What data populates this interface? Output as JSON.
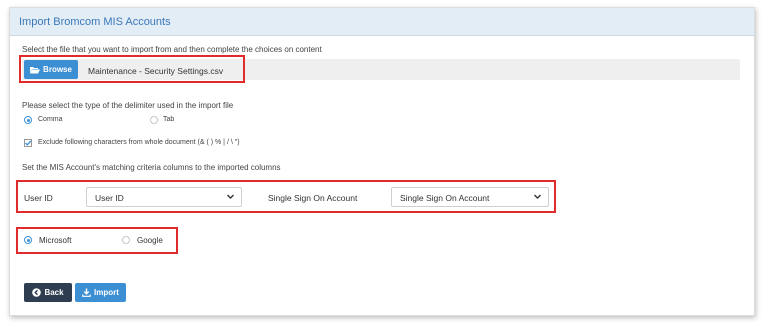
{
  "header": {
    "title": "Import Bromcom MIS Accounts"
  },
  "file_section": {
    "instruction": "Select the file that you want to import from and then complete the choices on content",
    "browse_label": "Browse",
    "file_name": "Maintenance - Security Settings.csv"
  },
  "delimiter": {
    "prompt": "Please select the type of the delimiter used in the import file",
    "options": [
      {
        "label": "Comma",
        "selected": true
      },
      {
        "label": "Tab",
        "selected": false
      }
    ]
  },
  "exclude": {
    "label": "Exclude following characters from whole document (& ( ) % | / \\ \")",
    "checked": true
  },
  "matching": {
    "prompt": "Set the MIS Account's matching criteria columns to the imported columns",
    "user_id_label": "User ID",
    "user_id_value": "User ID",
    "sso_label": "Single Sign On Account",
    "sso_value": "Single Sign On Account"
  },
  "provider": {
    "options": [
      {
        "label": "Microsoft",
        "selected": true
      },
      {
        "label": "Google",
        "selected": false
      }
    ]
  },
  "actions": {
    "back_label": "Back",
    "import_label": "Import"
  },
  "colors": {
    "accent": "#3d8fd4",
    "highlight_border": "#e02b2b",
    "back_button": "#2e3e50",
    "header_bg": "#e3edf6"
  }
}
